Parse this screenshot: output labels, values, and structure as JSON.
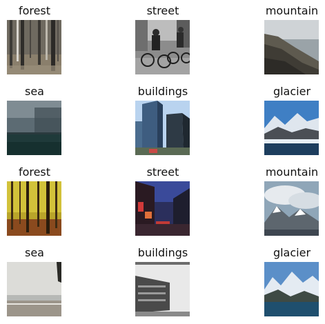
{
  "grid": {
    "rows": [
      [
        {
          "label": "forest",
          "image": "forest-photo"
        },
        {
          "label": "street",
          "image": "street-cyclists-photo"
        },
        {
          "label": "mountain",
          "image": "mountain-coast-photo"
        }
      ],
      [
        {
          "label": "sea",
          "image": "sea-storm-photo"
        },
        {
          "label": "buildings",
          "image": "glass-towers-photo"
        },
        {
          "label": "glacier",
          "image": "glacier-bay-photo"
        }
      ],
      [
        {
          "label": "forest",
          "image": "autumn-forest-photo"
        },
        {
          "label": "street",
          "image": "night-street-photo"
        },
        {
          "label": "mountain",
          "image": "cloudy-mountain-photo"
        }
      ],
      [
        {
          "label": "sea",
          "image": "grey-beach-photo"
        },
        {
          "label": "buildings",
          "image": "grey-building-photo"
        },
        {
          "label": "glacier",
          "image": "glacier-lake-photo"
        }
      ]
    ]
  }
}
